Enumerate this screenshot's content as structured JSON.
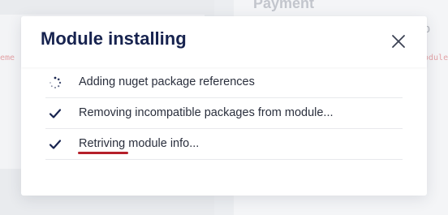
{
  "background": {
    "payment_heading": "Payment",
    "right_text": "nt p",
    "left_code": "eme",
    "right_code": "odule"
  },
  "modal": {
    "title": "Module installing",
    "close_icon": "close-icon",
    "items": [
      {
        "label": "Adding nuget package references",
        "status": "in-progress",
        "icon": "spinner-icon"
      },
      {
        "label": "Removing incompatible packages from module...",
        "status": "done",
        "icon": "check-icon"
      },
      {
        "label": "Retriving module info...",
        "status": "done",
        "icon": "check-icon"
      }
    ]
  },
  "colors": {
    "title": "#17234f",
    "icon": "#17234f",
    "spellcheck_underline": "#b51f2a"
  }
}
